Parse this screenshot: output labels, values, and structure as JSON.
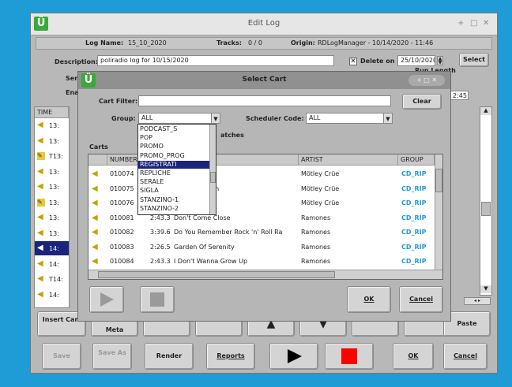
{
  "window": {
    "title": "Edit Log",
    "controls": [
      "+",
      "□",
      "✕"
    ]
  },
  "info": {
    "log_name_label": "Log Name:",
    "log_name": "15_10_2020",
    "tracks_label": "Tracks:",
    "tracks": "0 / 0",
    "origin_label": "Origin:",
    "origin": "RDLogManager - 10/14/2020 - 11:46"
  },
  "form": {
    "description_label": "Description:",
    "description": "poliradio log for 10/15/2020",
    "delete_on_label": "Delete on",
    "delete_on_checked": "✕",
    "delete_date": "25/10/2020",
    "select_label": "Select",
    "service_label": "Ser",
    "enabled_label": "Ena",
    "run_length_label": "Run Length",
    "run_length": "2:45"
  },
  "log_list": {
    "header": "TIME",
    "rows": [
      "13:",
      "13:",
      "T13:",
      "13:",
      "13:",
      "13:",
      "13:",
      "13:",
      "14:",
      "14:",
      "T14:",
      "14:"
    ]
  },
  "bottom_buttons": {
    "insert_cart": "Insert Cart",
    "insert_meta": "Meta",
    "paste": "Paste",
    "save": "Save",
    "save_as": "Save As",
    "render": "Render",
    "reports": "Reports",
    "ok": "OK",
    "cancel": "Cancel"
  },
  "dialog": {
    "title": "Select Cart",
    "cart_filter_label": "Cart Filter:",
    "cart_filter_value": "",
    "clear_label": "Clear",
    "group_label": "Group:",
    "group_value": "ALL",
    "scheduler_label": "Scheduler Code:",
    "scheduler_value": "ALL",
    "matches_label": "atches",
    "carts_label": "Carts",
    "columns": [
      "NUMBER",
      "",
      "",
      "ARTIST",
      "GROUP"
    ],
    "rows": [
      {
        "number": "010074",
        "length": "",
        "title": "ame Of",
        "artist": "Mötley Crüe",
        "group": "CD_RIP"
      },
      {
        "number": "010075",
        "length": "",
        "title": "he Boys Room",
        "artist": "Mötley Crüe",
        "group": "CD_RIP"
      },
      {
        "number": "010076",
        "length": "",
        "title": "Love",
        "artist": "Mötley Crüe",
        "group": "CD_RIP"
      },
      {
        "number": "010081",
        "length": "2:43.3",
        "title": "Don't Come Close",
        "artist": "Ramones",
        "group": "CD_RIP"
      },
      {
        "number": "010082",
        "length": "3:39.6",
        "title": "Do You Remember Rock 'n' Roll Ra",
        "artist": "Ramones",
        "group": "CD_RIP"
      },
      {
        "number": "010083",
        "length": "2:26.5",
        "title": "Garden Of Serenity",
        "artist": "Ramones",
        "group": "CD_RIP"
      },
      {
        "number": "010084",
        "length": "2:43.3",
        "title": "I Don't Wanna Grow Up",
        "artist": "Ramones",
        "group": "CD_RIP"
      }
    ],
    "ok_label": "OK",
    "cancel_label": "Cancel",
    "group_options": [
      "PODCAST_S",
      "POP",
      "PROMO",
      "PROMO_PROG",
      "REGISTRATI",
      "REPLICHE",
      "SERALE",
      "SIGLA",
      "STANZINO-1",
      "STANZINO-2"
    ],
    "group_selected": "REGISTRATI"
  },
  "colors": {
    "accent": "#1f9bd6",
    "selection": "#1a237e",
    "stop": "#ff0000"
  }
}
